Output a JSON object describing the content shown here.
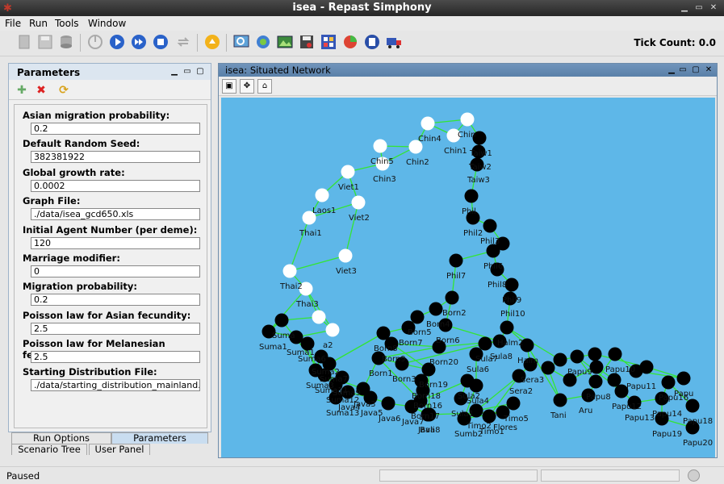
{
  "window": {
    "title": "isea - Repast Simphony",
    "app_icon": "repast-app-icon"
  },
  "menu": [
    "File",
    "Run",
    "Tools",
    "Window"
  ],
  "toolbar": {
    "tick_label": "Tick Count: 0.0",
    "buttons": [
      "load-model-icon",
      "save-icon",
      "database-icon",
      "init-icon",
      "play-icon",
      "step-icon",
      "stop-icon",
      "reset-icon",
      "jar-icon",
      "zoom-icon",
      "web-icon",
      "image-icon",
      "save-output-icon",
      "grid-icon",
      "pie-chart-icon",
      "layers-icon",
      "truck-icon"
    ]
  },
  "params_panel": {
    "title": "Parameters",
    "items": [
      {
        "label": "Asian migration probability:",
        "value": "0.2"
      },
      {
        "label": "Default Random Seed:",
        "value": "382381922"
      },
      {
        "label": "Global growth rate:",
        "value": "0.0002"
      },
      {
        "label": "Graph File:",
        "value": "./data/isea_gcd650.xls"
      },
      {
        "label": "Initial Agent Number (per deme):",
        "value": "120"
      },
      {
        "label": "Marriage modifier:",
        "value": "0"
      },
      {
        "label": "Migration probability:",
        "value": "0.2"
      },
      {
        "label": "Poisson law for Asian fecundity:",
        "value": "2.5"
      },
      {
        "label": "Poisson law for Melanesian fecundity:",
        "value": "2.5"
      },
      {
        "label": "Starting Distribution File:",
        "value": "./data/starting_distribution_mainland.csv"
      }
    ],
    "tabs_row1": [
      "Run Options",
      "Parameters"
    ],
    "tabs_row2": [
      "Scenario Tree",
      "User Panel"
    ]
  },
  "network": {
    "title": "isea: Situated Network",
    "colors": {
      "background": "#5eb7e8",
      "edge": "#33e533",
      "asian_node": "#ffffff",
      "other_node": "#000000"
    },
    "white_nodes": [
      {
        "label": "Chin4"
      },
      {
        "label": "Chin"
      },
      {
        "label": "Chin1"
      },
      {
        "label": "Chin2"
      },
      {
        "label": "Chin5"
      },
      {
        "label": "Chin3"
      },
      {
        "label": "Viet1"
      },
      {
        "label": "Laos1"
      },
      {
        "label": "Viet2"
      },
      {
        "label": "Thai1"
      },
      {
        "label": "Viet3"
      },
      {
        "label": "Thai2"
      },
      {
        "label": "Thai3"
      },
      {
        "label": ""
      },
      {
        "label": "a2"
      }
    ],
    "black_nodes": [
      {
        "label": "Taiw1"
      },
      {
        "label": "Taiw2"
      },
      {
        "label": "Taiw3"
      },
      {
        "label": "Phil"
      },
      {
        "label": "Phil2"
      },
      {
        "label": "Phil3"
      },
      {
        "label": ""
      },
      {
        "label": "Phil6"
      },
      {
        "label": "Phil7"
      },
      {
        "label": "Phil8"
      },
      {
        "label": "Phil9"
      },
      {
        "label": "Phil10"
      },
      {
        "label": "Born2"
      },
      {
        "label": "Born4"
      },
      {
        "label": "Born5"
      },
      {
        "label": "Born7"
      },
      {
        "label": "Born6"
      },
      {
        "label": "Born8"
      },
      {
        "label": "Born9"
      },
      {
        "label": "Born20"
      },
      {
        "label": "Born1"
      },
      {
        "label": "Born3"
      },
      {
        "label": "Born19"
      },
      {
        "label": "Born18"
      },
      {
        "label": "Born17"
      },
      {
        "label": "Born16"
      },
      {
        "label": "Bali"
      },
      {
        "label": "Sula8"
      },
      {
        "label": "Sula7"
      },
      {
        "label": "Sula6"
      },
      {
        "label": "Sula4"
      },
      {
        "label": "Sula2"
      },
      {
        "label": "Sula1"
      },
      {
        "label": "Halm2"
      },
      {
        "label": "Halm"
      },
      {
        "label": "Sera3"
      },
      {
        "label": "Sera2"
      },
      {
        "label": "Timo1"
      },
      {
        "label": "Timo5"
      },
      {
        "label": "Timo2"
      },
      {
        "label": "Sumb2"
      },
      {
        "label": "Flores"
      },
      {
        "label": "Tani"
      },
      {
        "label": "Aru"
      },
      {
        "label": "Papu8"
      },
      {
        "label": "Papu10"
      },
      {
        "label": "Papu11"
      },
      {
        "label": "Papu9"
      },
      {
        "label": "Papu12"
      },
      {
        "label": "Papu13"
      },
      {
        "label": "Papu14"
      },
      {
        "label": "Papu16"
      },
      {
        "label": "Papu18"
      },
      {
        "label": "Papu19"
      },
      {
        "label": "Papu20"
      },
      {
        "label": "Papu"
      },
      {
        "label": "Suma1"
      },
      {
        "label": "Suma"
      },
      {
        "label": "Suma11"
      },
      {
        "label": "Suma12"
      },
      {
        "label": "Suma13"
      },
      {
        "label": "Java4"
      },
      {
        "label": "Java5"
      },
      {
        "label": "Java6"
      },
      {
        "label": "Java7"
      },
      {
        "label": "Java8"
      },
      {
        "label": "Java3"
      },
      {
        "label": "Suma1"
      },
      {
        "label": "Suma6"
      },
      {
        "label": "Suma3"
      },
      {
        "label": "Suma2"
      },
      {
        "label": "Suma9"
      },
      {
        "label": "Suma7"
      },
      {
        "label": ""
      },
      {
        "label": ""
      },
      {
        "label": ""
      },
      {
        "label": ""
      },
      {
        "label": ""
      },
      {
        "label": ""
      },
      {
        "label": ""
      }
    ]
  },
  "status": {
    "text": "Paused"
  }
}
